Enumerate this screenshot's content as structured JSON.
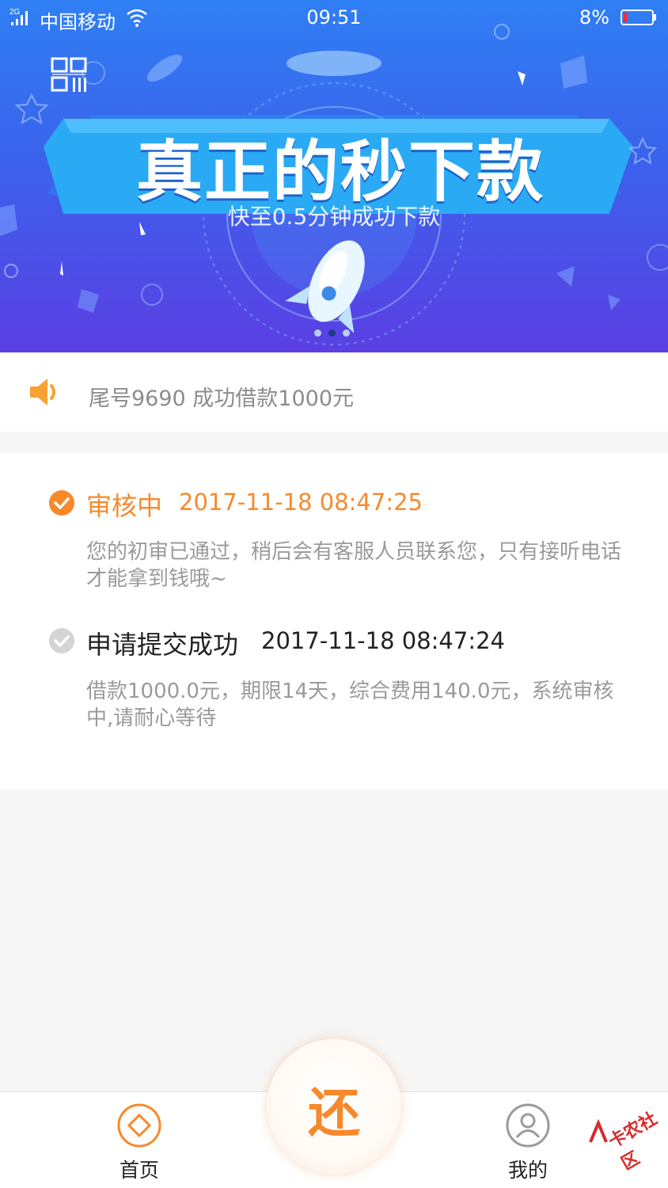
{
  "status_bar": {
    "network": "2G",
    "carrier": "中国移动",
    "time": "09:51",
    "battery": "8%"
  },
  "banner": {
    "title": "真正的秒下款",
    "subtitle": "快至0.5分钟成功下款",
    "active_slide": 2,
    "slide_count": 3
  },
  "notice": {
    "text": "尾号9690 成功借款1000元"
  },
  "timeline": [
    {
      "title": "审核中",
      "time": "2017-11-18 08:47:25",
      "desc": "您的初审已通过，稍后会有客服人员联系您，只有接听电话才能拿到钱哦~",
      "status": "active"
    },
    {
      "title": "申请提交成功",
      "time": "2017-11-18 08:47:24",
      "desc": "借款1000.0元，期限14天，综合费用140.0元，系统审核中,请耐心等待",
      "status": "done"
    }
  ],
  "bottom_nav": {
    "home_label": "首页",
    "repay_label": "还",
    "mine_label": "我的"
  },
  "watermark": "卡农社区",
  "colors": {
    "accent": "#f7892b",
    "banner_top": "#2f7ff4",
    "banner_bottom": "#5b3fe3",
    "muted_text": "#9a9a9a"
  },
  "icons": [
    "qr-code-icon",
    "speaker-icon",
    "check-circle-icon",
    "home-diamond-icon",
    "user-icon"
  ]
}
